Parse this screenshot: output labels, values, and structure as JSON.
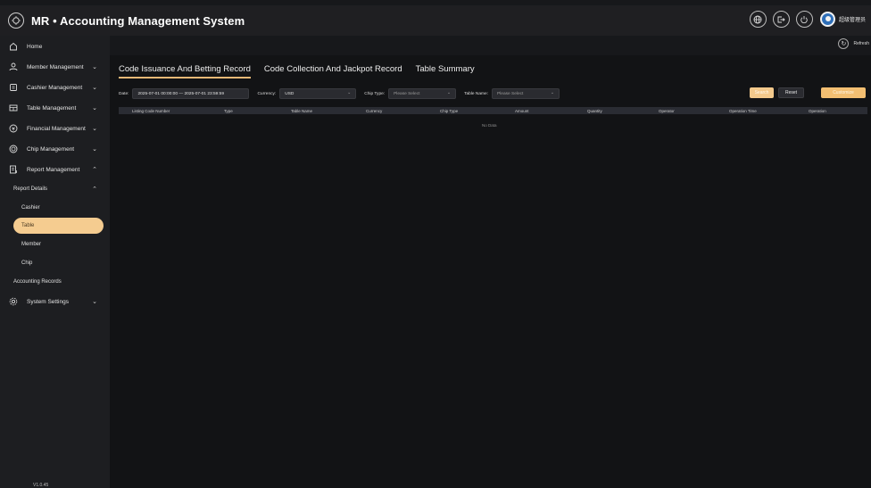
{
  "app": {
    "title": "MR • Accounting Management System"
  },
  "header": {
    "icons": [
      "globe-icon",
      "logout-icon",
      "power-icon"
    ],
    "username": "超级管理员"
  },
  "sidebar": {
    "items": [
      {
        "label": "Home",
        "icon": "home-icon"
      },
      {
        "label": "Member Management",
        "icon": "users-icon"
      },
      {
        "label": "Cashier Management",
        "icon": "cashier-icon"
      },
      {
        "label": "Table Management",
        "icon": "table-icon"
      },
      {
        "label": "Financial Management",
        "icon": "finance-icon"
      },
      {
        "label": "Chip Management",
        "icon": "chip-icon"
      },
      {
        "label": "Report Management",
        "icon": "report-icon"
      }
    ],
    "report_sub": {
      "group": "Report Details",
      "children": [
        "Cashier",
        "Table",
        "Member",
        "Chip"
      ],
      "active": "Table",
      "accounting": "Accounting Records"
    },
    "system": {
      "label": "System Settings",
      "icon": "settings-icon"
    },
    "version": "V1.0.45"
  },
  "main": {
    "refresh_label": "Refresh",
    "tabs": [
      "Code Issuance And Betting Record",
      "Code Collection And Jackpot Record",
      "Table Summary"
    ],
    "active_tab": "Code Issuance And Betting Record",
    "filters": {
      "date_label": "Date:",
      "date_value": "2025-07-01 00:00:00 — 2025-07-01 23:59:59",
      "currency_label": "Currency:",
      "currency_value": "USD",
      "chip_type_label": "Chip Type:",
      "chip_type_placeholder": "Please Select",
      "table_name_label": "Table Name:",
      "table_name_placeholder": "Please Select"
    },
    "buttons": {
      "search": "Search",
      "reset": "Reset",
      "customize": "Customize"
    },
    "table": {
      "columns": [
        "Listing Code Number",
        "Type",
        "Table Name",
        "Currency",
        "Chip Type",
        "Amount",
        "Quantity",
        "Operator",
        "Operation Time",
        "Operation"
      ],
      "empty_text": "No Data"
    }
  }
}
